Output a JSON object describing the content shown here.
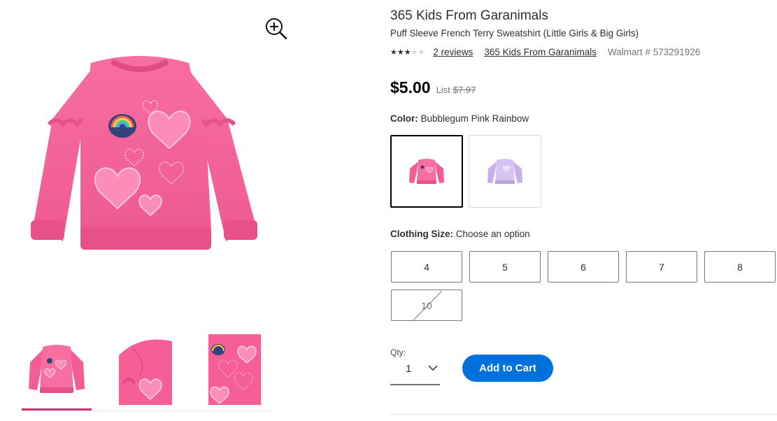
{
  "product": {
    "brand_title": "365 Kids From Garanimals",
    "subtitle": "Puff Sleeve French Terry Sweatshirt (Little Girls & Big Girls)",
    "rating_stars": 3,
    "rating_max": 5,
    "reviews_link": "2 reviews",
    "brand_link": "365 Kids From Garanimals",
    "item_number": "Walmart # 573291926"
  },
  "gallery": {
    "zoom_icon": "zoom-in-icon",
    "hero_alt": "Pink puff sleeve sweatshirt with rainbow and heart graphics",
    "thumbnails": [
      "front view",
      "sleeve detail",
      "print detail"
    ],
    "selected_thumb": 1
  },
  "price": {
    "current": "$5.00",
    "list_label": "List",
    "list_price": "$7.97"
  },
  "color": {
    "label": "Color:",
    "selected": "Bubblegum Pink Rainbow",
    "options": [
      {
        "name": "Bubblegum Pink Rainbow",
        "hex": "#f35d95"
      },
      {
        "name": "Lavender",
        "hex": "#cdb6ea"
      }
    ]
  },
  "size": {
    "label": "Clothing Size:",
    "prompt": "Choose an option",
    "options": [
      {
        "label": "4",
        "available": true
      },
      {
        "label": "5",
        "available": true
      },
      {
        "label": "6",
        "available": true
      },
      {
        "label": "7",
        "available": true
      },
      {
        "label": "8",
        "available": true
      },
      {
        "label": "10",
        "available": false
      }
    ]
  },
  "purchase": {
    "qty_label": "Qty:",
    "qty_value": "1",
    "add_to_cart": "Add to Cart"
  },
  "colors": {
    "accent_blue": "#0071dc",
    "thumb_underline": "#c4306f",
    "sweatshirt_pink": "#f35d95"
  }
}
